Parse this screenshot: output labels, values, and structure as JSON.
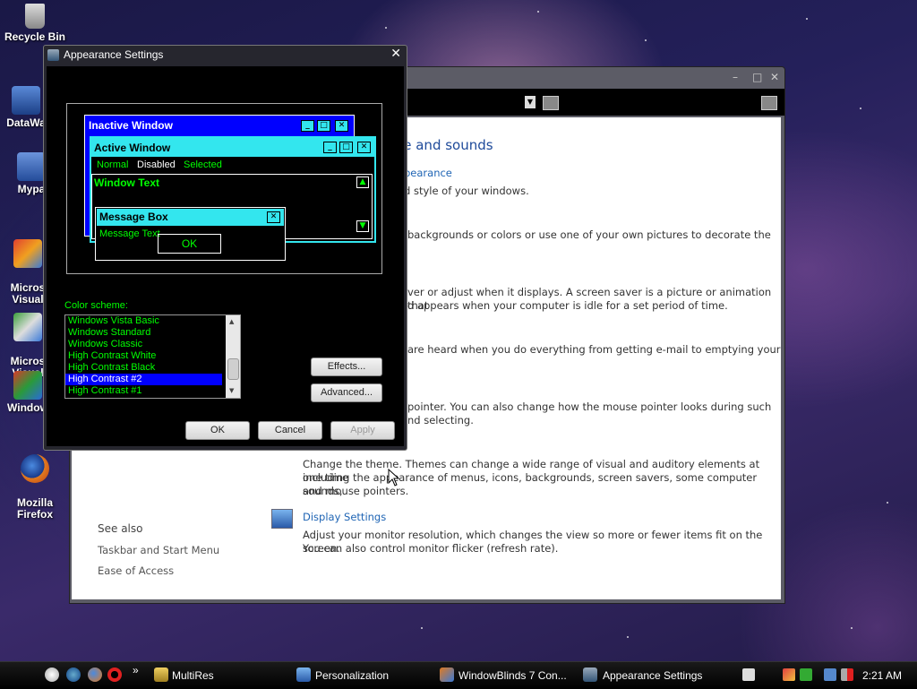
{
  "desktop": {
    "icons": [
      {
        "label": "Recycle Bin"
      },
      {
        "label": "DataWa"
      },
      {
        "label": "Mypa"
      },
      {
        "label": "Micros\nVisual"
      },
      {
        "label": "Micros\nVisual"
      },
      {
        "label": "Window"
      },
      {
        "label": "Mozilla\nFirefox"
      }
    ]
  },
  "personalization": {
    "heading": "ce and sounds",
    "link_appearance": "pearance",
    "text1": "d style of your windows.",
    "text2": "backgrounds or colors or use one of your own pictures to decorate the",
    "text3a": "ver or adjust when it displays. A screen saver is a picture or animation that",
    "text3b": "d appears when your computer is idle for a set period of time.",
    "text4a": "are heard when you do everything from getting e-mail to emptying your",
    "text5a": "pointer. You can also change how the mouse pointer looks during such",
    "text5b": "nd selecting.",
    "text6a": "Change the theme. Themes can change a wide range of visual and auditory elements at one time",
    "text6b": "including the appearance of menus, icons, backgrounds, screen savers, some computer sounds,",
    "text6c": "and mouse pointers.",
    "display_link": "Display Settings",
    "display_text_a": "Adjust your monitor resolution, which changes the view so more or fewer items fit on the screen.",
    "display_text_b": "You can also control monitor flicker (refresh rate).",
    "see_also": {
      "title": "See also",
      "items": [
        "Taskbar and Start Menu",
        "Ease of Access"
      ]
    }
  },
  "dialog": {
    "title": "Appearance Settings",
    "preview": {
      "inactive_title": "Inactive Window",
      "active_title": "Active Window",
      "menu_normal": "Normal",
      "menu_disabled": "Disabled",
      "menu_selected": "Selected",
      "window_text": "Window Text",
      "msgbox_title": "Message Box",
      "msgbox_text": "Message Text",
      "ok": "OK"
    },
    "color_scheme_label": "Color scheme:",
    "schemes": [
      "Windows Vista Basic",
      "Windows Standard",
      "Windows Classic",
      "High Contrast White",
      "High Contrast Black",
      "High Contrast #2",
      "High Contrast #1"
    ],
    "selected_scheme": "High Contrast #2",
    "effects_btn": "Effects...",
    "advanced_btn": "Advanced...",
    "ok_btn": "OK",
    "cancel_btn": "Cancel",
    "apply_btn": "Apply"
  },
  "taskbar": {
    "items": [
      {
        "label": "MultiRes"
      },
      {
        "label": "Personalization"
      },
      {
        "label": "WindowBlinds 7 Con..."
      },
      {
        "label": "Appearance Settings"
      }
    ],
    "chevron": "»",
    "clock": "2:21 AM"
  },
  "colors": {
    "hc_cyan": "#33e6ee",
    "hc_blue": "#0000ff",
    "hc_green": "#00ff00",
    "link": "#1e64b4"
  }
}
